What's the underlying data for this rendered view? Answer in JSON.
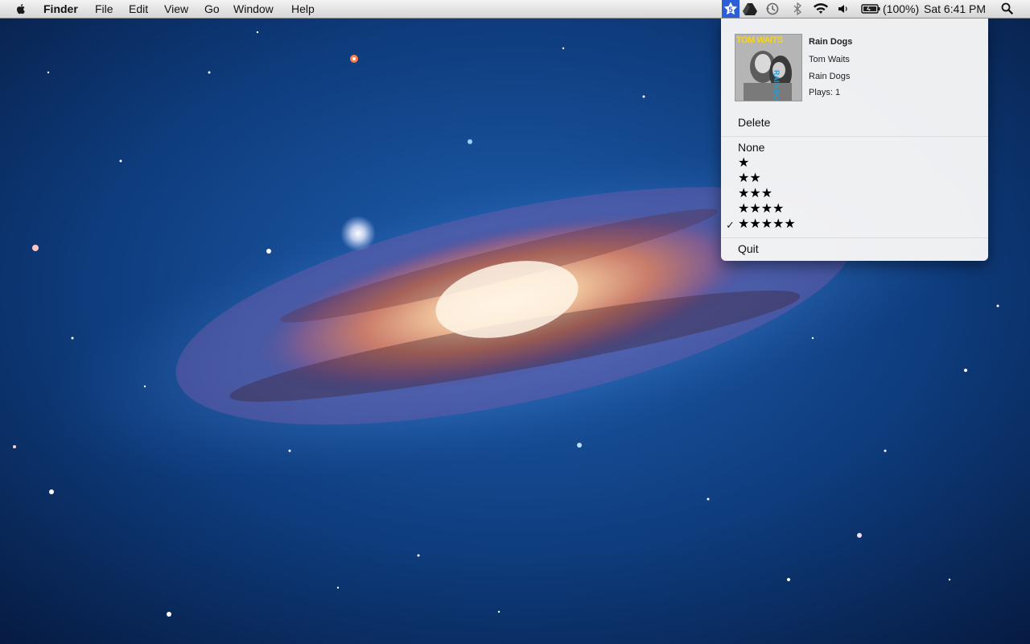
{
  "menubar": {
    "app_name": "Finder",
    "menus": [
      "File",
      "Edit",
      "View",
      "Go",
      "Window",
      "Help"
    ],
    "status": {
      "rating_badge": "5",
      "battery_text": "(100%)",
      "clock": "Sat 6:41 PM"
    },
    "icons": [
      "apple-logo-icon",
      "rating-star-icon",
      "drive-icon",
      "time-machine-icon",
      "bluetooth-icon",
      "wifi-icon",
      "volume-icon",
      "battery-icon",
      "spotlight-icon"
    ]
  },
  "track_menu": {
    "album_art_text": {
      "artist": "TOM WAITS",
      "album": "RAIN DOGS"
    },
    "title": "Rain Dogs",
    "artist": "Tom Waits",
    "album": "Rain Dogs",
    "plays": "Plays: 1",
    "delete_label": "Delete",
    "none_label": "None",
    "ratings": [
      "★",
      "★★",
      "★★★",
      "★★★★",
      "★★★★★"
    ],
    "selected_rating": 5,
    "checkmark": "✓",
    "quit_label": "Quit"
  },
  "colors": {
    "menubar_bg": "#e4e4e4",
    "menu_bg": "#f6f6f6",
    "highlight_blue": "#2a5fd8",
    "wallpaper_space": "#0d3a78"
  }
}
